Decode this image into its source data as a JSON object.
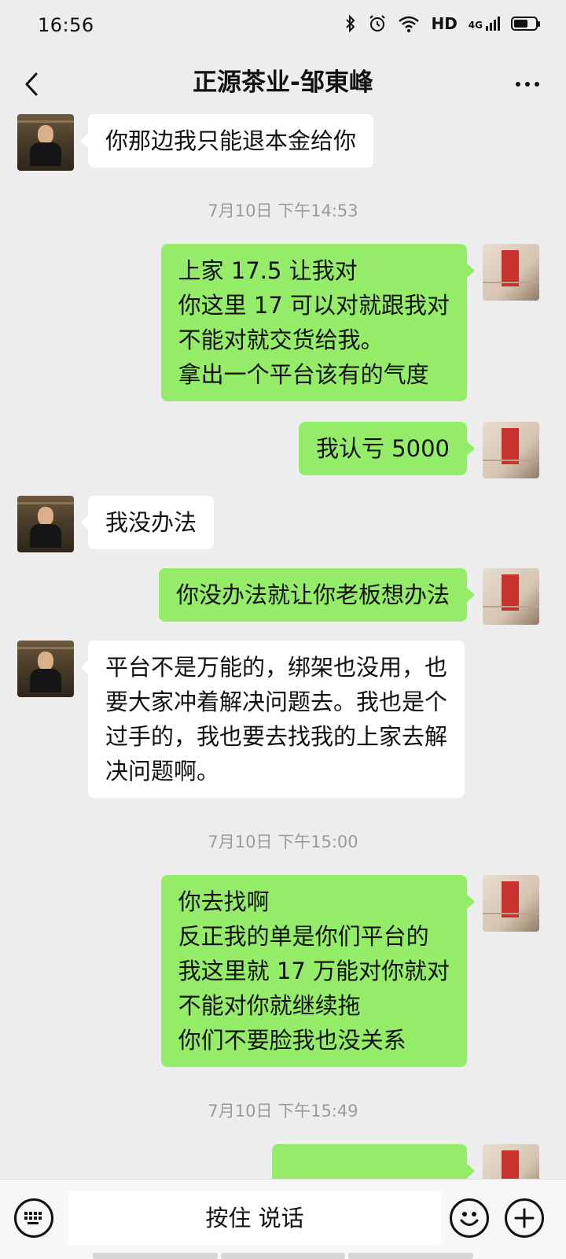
{
  "status_bar": {
    "time": "16:56",
    "network": "HD",
    "signal": "4G",
    "battery_level": 0.65
  },
  "header": {
    "title": "正源茶业-邹東峰"
  },
  "messages": [
    {
      "side": "left",
      "text": "你那边我只能退本金给你"
    },
    {
      "type": "timestamp",
      "text": "7月10日 下午14:53"
    },
    {
      "side": "right",
      "text": "上家 17.5 让我对\n你这里 17 可以对就跟我对\n不能对就交货给我。\n拿出一个平台该有的气度"
    },
    {
      "side": "right",
      "text": "我认亏 5000"
    },
    {
      "side": "left",
      "text": "我没办法"
    },
    {
      "side": "right",
      "text": "你没办法就让你老板想办法"
    },
    {
      "side": "left",
      "text": "平台不是万能的，绑架也没用，也\n要大家冲着解决问题去。我也是个\n过手的，我也要去找我的上家去解\n决问题啊。"
    },
    {
      "type": "timestamp",
      "text": "7月10日 下午15:00"
    },
    {
      "side": "right",
      "text": "你去找啊\n反正我的单是你们平台的\n我这里就 17 万能对你就对\n不能对你就继续拖\n你们不要脸我也没关系"
    },
    {
      "type": "timestamp",
      "text": "7月10日 下午15:49"
    }
  ],
  "input_bar": {
    "voice_label": "按住 说话"
  },
  "icons": {
    "back": "chevron-left-icon",
    "more": "more-icon",
    "keyboard": "keyboard-icon",
    "emoji": "emoji-icon",
    "add": "plus-icon"
  }
}
